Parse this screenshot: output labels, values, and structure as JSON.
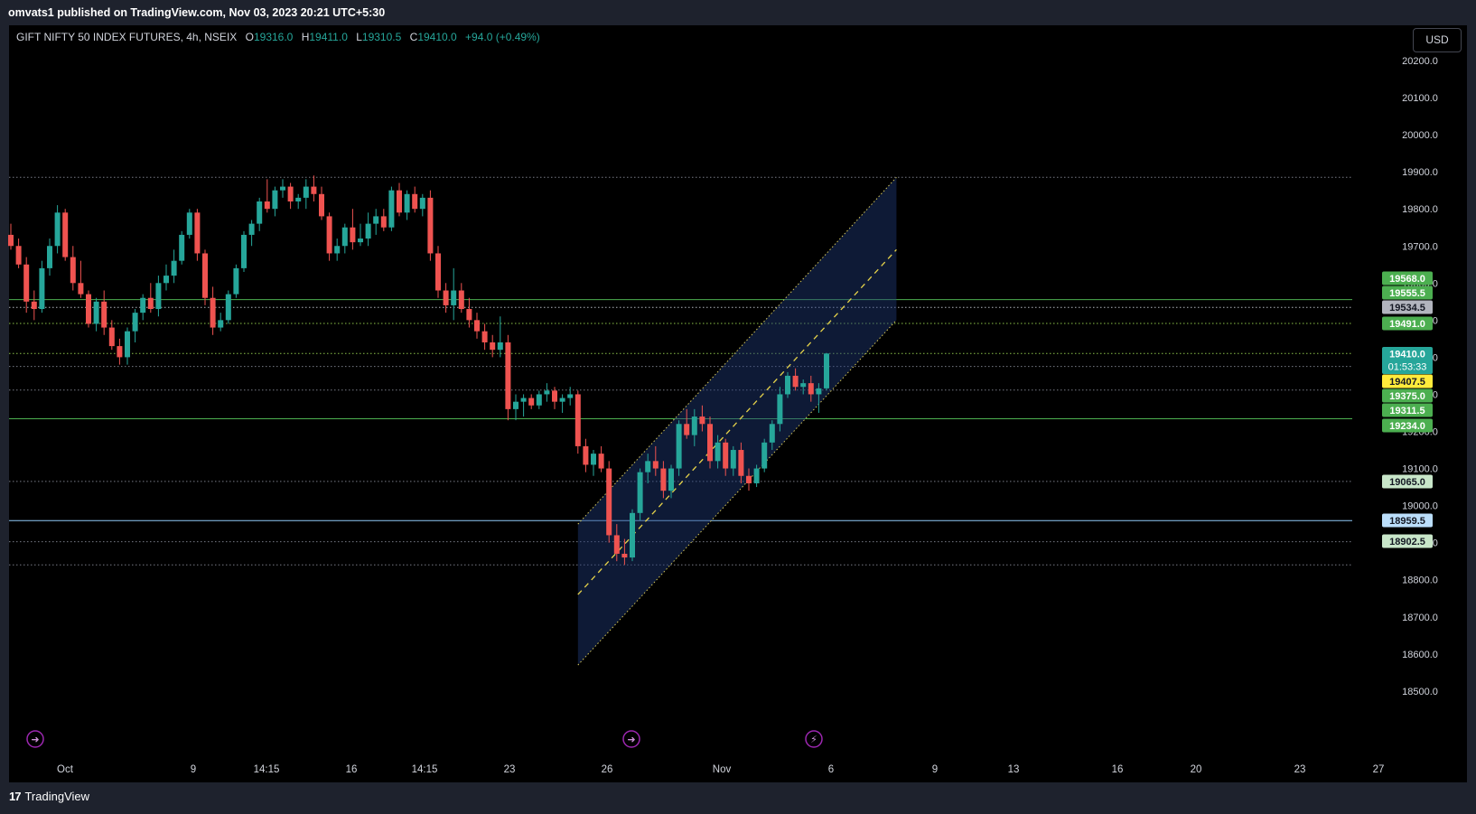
{
  "header": {
    "published": "omvats1 published on TradingView.com, Nov 03, 2023 20:21 UTC+5:30"
  },
  "legend": {
    "symbol": "GIFT NIFTY 50 INDEX FUTURES, 4h, NSEIX",
    "o_label": "O",
    "o": "19316.0",
    "h_label": "H",
    "h": "19411.0",
    "l_label": "L",
    "l": "19310.5",
    "c_label": "C",
    "c": "19410.0",
    "change": "+94.0 (+0.49%)"
  },
  "currency_button": "USD",
  "footer": {
    "brand": "TradingView",
    "brand_mark": "17"
  },
  "colors": {
    "up": "#26a69a",
    "down": "#ef5350",
    "channel": "#1e3a78",
    "level_green": "#4caf50",
    "level_blue": "#90caf9"
  },
  "chart_data": {
    "type": "candlestick",
    "timeframe": "4h",
    "ylim": [
      18450,
      20260
    ],
    "y_ticks": [
      "20200.0",
      "20100.0",
      "20000.0",
      "19900.0",
      "19800.0",
      "19700.0",
      "19600.0",
      "19500.0",
      "19400.0",
      "19300.0",
      "19200.0",
      "19100.0",
      "19000.0",
      "18900.0",
      "18800.0",
      "18700.0",
      "18600.0",
      "18500.0"
    ],
    "x_ticks": [
      {
        "label": "Oct",
        "i": 2
      },
      {
        "label": "9",
        "i": 22
      },
      {
        "label": "14:15",
        "i": 30
      },
      {
        "label": "16",
        "i": 40
      },
      {
        "label": "14:15",
        "i": 49
      },
      {
        "label": "23",
        "i": 59
      },
      {
        "label": "26",
        "i": 71
      },
      {
        "label": "Nov",
        "i": 85
      },
      {
        "label": "6",
        "i": 98
      },
      {
        "label": "9",
        "i": 110
      },
      {
        "label": "13",
        "i": 119
      },
      {
        "label": "16",
        "i": 132
      },
      {
        "label": "20",
        "i": 141
      },
      {
        "label": "23",
        "i": 154
      },
      {
        "label": "27",
        "i": 163
      }
    ],
    "price_labels": [
      {
        "value": "19568.0",
        "bg": "#4caf50",
        "fg": "#ffffff"
      },
      {
        "value": "19555.5",
        "bg": "#4caf50",
        "fg": "#ffffff"
      },
      {
        "value": "19534.5",
        "bg": "#b2b5be",
        "fg": "#131722"
      },
      {
        "value": "19491.0",
        "bg": "#4caf50",
        "fg": "#ffffff"
      },
      {
        "value": "19410.0",
        "bg": "#26a69a",
        "fg": "#ffffff",
        "sub": "01:53:33"
      },
      {
        "value": "19407.5",
        "bg": "#ffeb3b",
        "fg": "#131722"
      },
      {
        "value": "19375.0",
        "bg": "#4caf50",
        "fg": "#ffffff"
      },
      {
        "value": "19311.5",
        "bg": "#4caf50",
        "fg": "#ffffff"
      },
      {
        "value": "19234.0",
        "bg": "#4caf50",
        "fg": "#ffffff"
      },
      {
        "value": "19065.0",
        "bg": "#c8e6c9",
        "fg": "#131722"
      },
      {
        "value": "18959.5",
        "bg": "#bbdefb",
        "fg": "#131722"
      },
      {
        "value": "18902.5",
        "bg": "#c8e6c9",
        "fg": "#131722"
      }
    ],
    "levels": [
      {
        "price": 19885,
        "style": "dotted",
        "color": "#787b86"
      },
      {
        "price": 19555.5,
        "style": "solid",
        "color": "#4caf50"
      },
      {
        "price": 19534.5,
        "style": "dotted",
        "color": "#b2b5be"
      },
      {
        "price": 19491,
        "style": "dotted",
        "color": "#8bc34a"
      },
      {
        "price": 19410,
        "style": "dotted",
        "color": "#8bc34a"
      },
      {
        "price": 19375,
        "style": "dotted",
        "color": "#787b86"
      },
      {
        "price": 19311.5,
        "style": "dotted",
        "color": "#787b86"
      },
      {
        "price": 19234,
        "style": "solid",
        "color": "#4caf50"
      },
      {
        "price": 19065,
        "style": "dotted",
        "color": "#787b86"
      },
      {
        "price": 18959.5,
        "style": "solid",
        "color": "#90caf9"
      },
      {
        "price": 18902.5,
        "style": "dotted",
        "color": "#787b86"
      },
      {
        "price": 18840,
        "style": "dotted",
        "color": "#787b86"
      }
    ],
    "channel": {
      "start_i": 73,
      "end_i": 114,
      "upper": [
        18950,
        19885
      ],
      "mid": [
        18760,
        19690
      ],
      "lower": [
        18570,
        19500
      ]
    },
    "candles": [
      [
        19730,
        19760,
        19690,
        19700
      ],
      [
        19700,
        19720,
        19640,
        19650
      ],
      [
        19650,
        19670,
        19520,
        19550
      ],
      [
        19550,
        19580,
        19500,
        19530
      ],
      [
        19530,
        19660,
        19520,
        19640
      ],
      [
        19640,
        19720,
        19620,
        19700
      ],
      [
        19700,
        19810,
        19680,
        19790
      ],
      [
        19790,
        19800,
        19660,
        19670
      ],
      [
        19670,
        19700,
        19580,
        19600
      ],
      [
        19600,
        19660,
        19560,
        19570
      ],
      [
        19570,
        19580,
        19480,
        19490
      ],
      [
        19490,
        19560,
        19470,
        19550
      ],
      [
        19550,
        19580,
        19460,
        19480
      ],
      [
        19480,
        19500,
        19420,
        19430
      ],
      [
        19430,
        19450,
        19380,
        19400
      ],
      [
        19400,
        19480,
        19380,
        19470
      ],
      [
        19470,
        19530,
        19440,
        19520
      ],
      [
        19520,
        19570,
        19500,
        19560
      ],
      [
        19560,
        19600,
        19520,
        19530
      ],
      [
        19530,
        19620,
        19510,
        19600
      ],
      [
        19600,
        19650,
        19580,
        19620
      ],
      [
        19620,
        19690,
        19600,
        19660
      ],
      [
        19660,
        19740,
        19650,
        19730
      ],
      [
        19730,
        19800,
        19720,
        19790
      ],
      [
        19790,
        19800,
        19660,
        19680
      ],
      [
        19680,
        19690,
        19540,
        19560
      ],
      [
        19560,
        19590,
        19460,
        19480
      ],
      [
        19480,
        19520,
        19470,
        19500
      ],
      [
        19500,
        19580,
        19490,
        19570
      ],
      [
        19570,
        19650,
        19560,
        19640
      ],
      [
        19640,
        19740,
        19630,
        19730
      ],
      [
        19730,
        19770,
        19700,
        19760
      ],
      [
        19760,
        19830,
        19740,
        19820
      ],
      [
        19820,
        19880,
        19790,
        19800
      ],
      [
        19800,
        19860,
        19780,
        19850
      ],
      [
        19850,
        19880,
        19830,
        19860
      ],
      [
        19860,
        19870,
        19800,
        19820
      ],
      [
        19820,
        19840,
        19800,
        19830
      ],
      [
        19830,
        19880,
        19800,
        19860
      ],
      [
        19860,
        19890,
        19820,
        19840
      ],
      [
        19840,
        19860,
        19770,
        19780
      ],
      [
        19780,
        19790,
        19660,
        19680
      ],
      [
        19680,
        19720,
        19660,
        19700
      ],
      [
        19700,
        19760,
        19680,
        19750
      ],
      [
        19750,
        19800,
        19690,
        19710
      ],
      [
        19710,
        19760,
        19700,
        19720
      ],
      [
        19720,
        19790,
        19700,
        19760
      ],
      [
        19760,
        19800,
        19730,
        19780
      ],
      [
        19780,
        19800,
        19740,
        19750
      ],
      [
        19750,
        19860,
        19740,
        19850
      ],
      [
        19850,
        19870,
        19780,
        19790
      ],
      [
        19790,
        19850,
        19770,
        19840
      ],
      [
        19840,
        19860,
        19790,
        19800
      ],
      [
        19800,
        19840,
        19780,
        19830
      ],
      [
        19830,
        19850,
        19660,
        19680
      ],
      [
        19680,
        19700,
        19560,
        19580
      ],
      [
        19580,
        19600,
        19520,
        19540
      ],
      [
        19540,
        19640,
        19500,
        19580
      ],
      [
        19580,
        19600,
        19520,
        19530
      ],
      [
        19530,
        19560,
        19480,
        19500
      ],
      [
        19500,
        19520,
        19450,
        19470
      ],
      [
        19470,
        19490,
        19420,
        19440
      ],
      [
        19440,
        19460,
        19400,
        19420
      ],
      [
        19420,
        19510,
        19400,
        19440
      ],
      [
        19440,
        19460,
        19230,
        19260
      ],
      [
        19260,
        19300,
        19230,
        19280
      ],
      [
        19280,
        19300,
        19240,
        19290
      ],
      [
        19290,
        19300,
        19260,
        19270
      ],
      [
        19270,
        19310,
        19260,
        19300
      ],
      [
        19300,
        19330,
        19280,
        19310
      ],
      [
        19310,
        19320,
        19260,
        19280
      ],
      [
        19280,
        19300,
        19250,
        19290
      ],
      [
        19290,
        19320,
        19270,
        19300
      ],
      [
        19300,
        19310,
        19140,
        19160
      ],
      [
        19160,
        19180,
        19090,
        19110
      ],
      [
        19110,
        19150,
        19080,
        19140
      ],
      [
        19140,
        19160,
        19090,
        19100
      ],
      [
        19100,
        19120,
        18900,
        18920
      ],
      [
        18920,
        18950,
        18850,
        18870
      ],
      [
        18870,
        18910,
        18840,
        18860
      ],
      [
        18860,
        18990,
        18850,
        18980
      ],
      [
        18980,
        19100,
        18960,
        19090
      ],
      [
        19090,
        19140,
        19060,
        19120
      ],
      [
        19120,
        19160,
        19080,
        19100
      ],
      [
        19100,
        19120,
        19020,
        19040
      ],
      [
        19040,
        19110,
        19020,
        19100
      ],
      [
        19100,
        19230,
        19080,
        19220
      ],
      [
        19220,
        19260,
        19180,
        19190
      ],
      [
        19190,
        19260,
        19160,
        19240
      ],
      [
        19240,
        19270,
        19200,
        19220
      ],
      [
        19220,
        19240,
        19100,
        19120
      ],
      [
        19120,
        19190,
        19100,
        19170
      ],
      [
        19170,
        19180,
        19080,
        19100
      ],
      [
        19100,
        19160,
        19080,
        19150
      ],
      [
        19150,
        19170,
        19060,
        19080
      ],
      [
        19080,
        19100,
        19040,
        19060
      ],
      [
        19060,
        19110,
        19050,
        19100
      ],
      [
        19100,
        19180,
        19090,
        19170
      ],
      [
        19170,
        19230,
        19150,
        19220
      ],
      [
        19220,
        19320,
        19200,
        19300
      ],
      [
        19300,
        19360,
        19290,
        19350
      ],
      [
        19350,
        19370,
        19310,
        19320
      ],
      [
        19320,
        19340,
        19300,
        19330
      ],
      [
        19330,
        19350,
        19280,
        19300
      ],
      [
        19300,
        19330,
        19250,
        19316
      ],
      [
        19316,
        19411,
        19310.5,
        19410
      ]
    ]
  }
}
